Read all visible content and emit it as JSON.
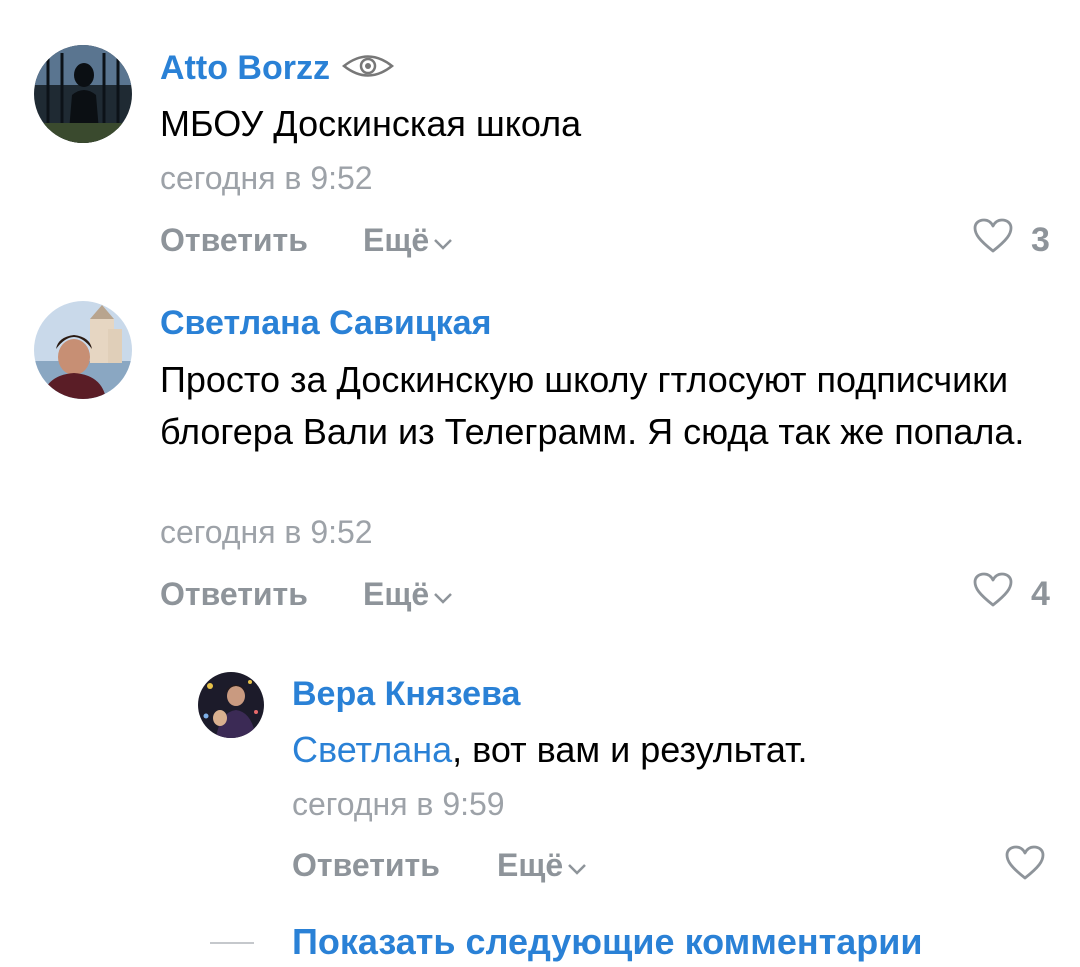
{
  "comments": [
    {
      "author": "Atto Borzz",
      "text": "МБОУ Доскинская школа",
      "time": "сегодня в 9:52",
      "reply_label": "Ответить",
      "more_label": "Ещё",
      "likes": "3"
    },
    {
      "author": "Светлана Савицкая",
      "text": "Просто за Доскинскую школу гтлосуют подписчики блогера Вали из Телеграмм. Я сюда так же попала.",
      "time": "сегодня в 9:52",
      "reply_label": "Ответить",
      "more_label": "Ещё",
      "likes": "4"
    }
  ],
  "reply": {
    "author": "Вера Князева",
    "mention": "Светлана",
    "text": ", вот вам и результат.",
    "time": "сегодня в 9:59",
    "reply_label": "Ответить",
    "more_label": "Ещё"
  },
  "show_more_label": "Показать следующие комментарии",
  "colors": {
    "link": "#2a81d6",
    "meta": "#9da2a8",
    "action": "#8e949a"
  },
  "icons": [
    "eye-icon",
    "chevron-down-icon",
    "heart-icon"
  ]
}
